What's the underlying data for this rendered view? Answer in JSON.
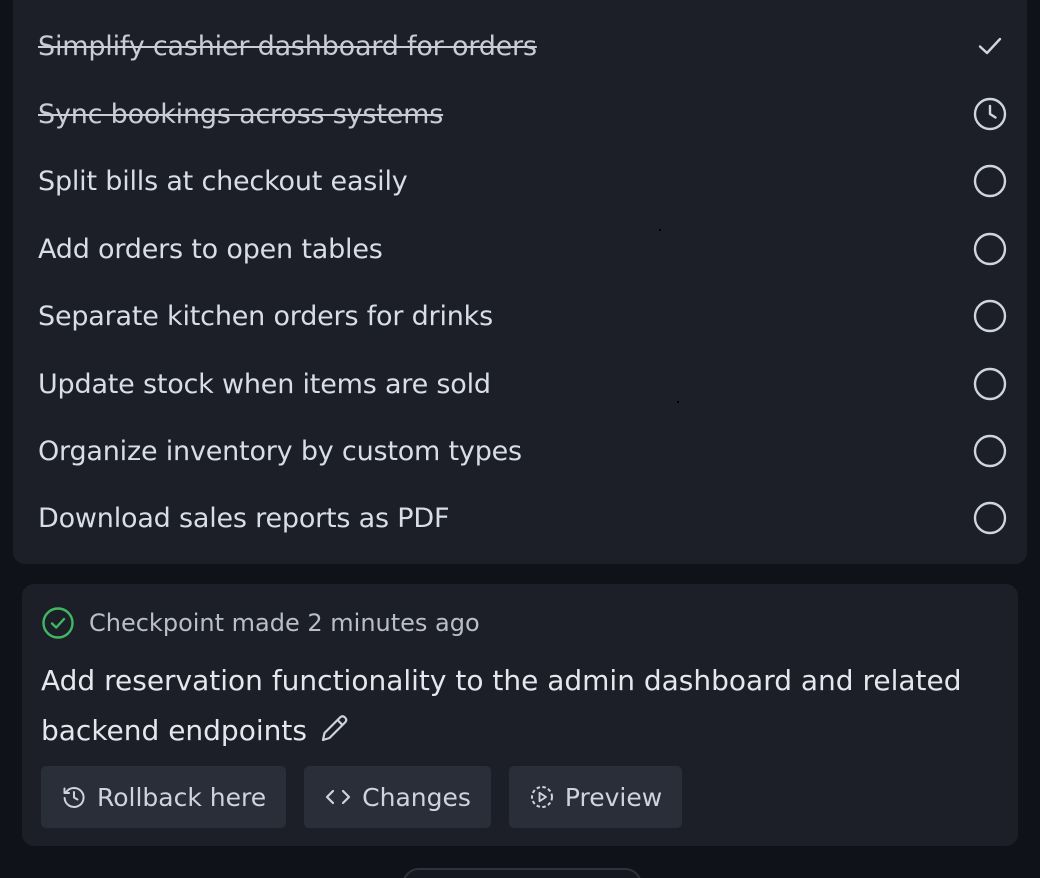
{
  "tasks": [
    {
      "label": "Simplify cashier dashboard for orders",
      "status": "done",
      "icon": "checkmark-icon"
    },
    {
      "label": "Sync bookings across systems",
      "status": "in-progress",
      "icon": "clock-icon"
    },
    {
      "label": "Split bills at checkout easily",
      "status": "pending",
      "icon": "circle-icon"
    },
    {
      "label": "Add orders to open tables",
      "status": "pending",
      "icon": "circle-icon"
    },
    {
      "label": "Separate kitchen orders for drinks",
      "status": "pending",
      "icon": "circle-icon"
    },
    {
      "label": "Update stock when items are sold",
      "status": "pending",
      "icon": "circle-icon"
    },
    {
      "label": "Organize inventory by custom types",
      "status": "pending",
      "icon": "circle-icon"
    },
    {
      "label": "Download sales reports as PDF",
      "status": "pending",
      "icon": "circle-icon"
    }
  ],
  "checkpoint": {
    "header": "Checkpoint made 2 minutes ago",
    "message": "Add reservation functionality to the admin dashboard and related backend endpoints",
    "actions": {
      "rollback_label": "Rollback here",
      "changes_label": "Changes",
      "preview_label": "Preview"
    }
  },
  "colors": {
    "background": "#0f1219",
    "panel": "#1c1f28",
    "button": "#2a2e38",
    "success": "#3fb862",
    "text": "#d9dde5"
  }
}
